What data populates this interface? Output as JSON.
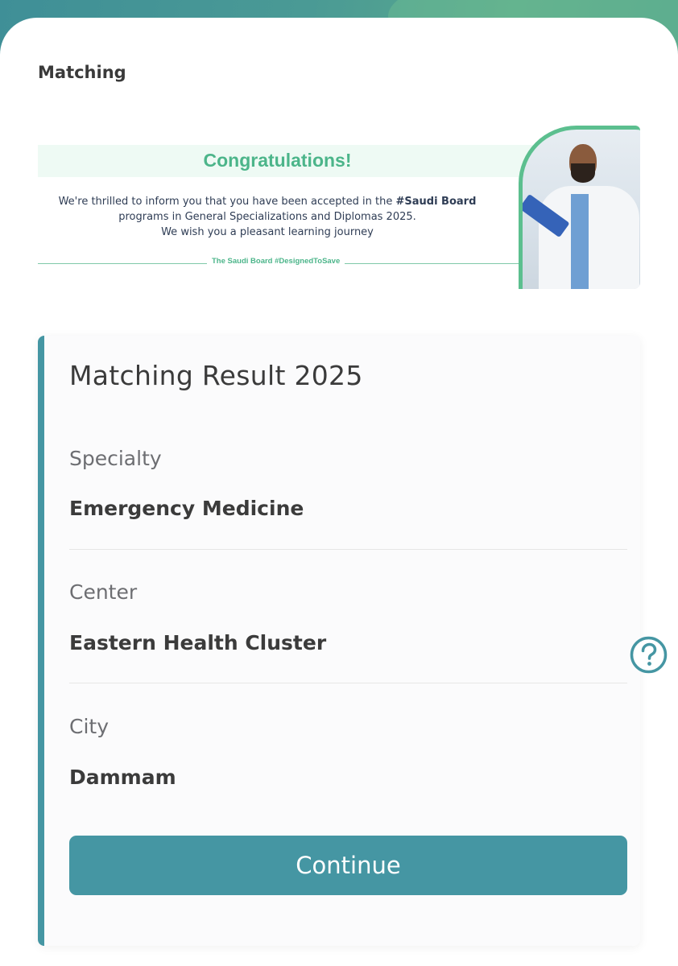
{
  "header": {
    "title": "Matching"
  },
  "banner": {
    "heading": "Congratulations!",
    "message_part1": "We're thrilled to inform you that you have been accepted in the ",
    "message_bold": "#Saudi Board",
    "message_part2": "programs in General Specializations and Diplomas 2025.",
    "message_part3": "We wish you a pleasant learning journey",
    "tagline": "The Saudi Board #DesignedToSave"
  },
  "result": {
    "title": "Matching Result 2025",
    "specialty_label": "Specialty",
    "specialty_value": "Emergency Medicine",
    "center_label": "Center",
    "center_value": "Eastern Health Cluster",
    "city_label": "City",
    "city_value": "Dammam",
    "continue_label": "Continue"
  },
  "colors": {
    "accent": "#4596a3",
    "banner_green": "#4cb58a",
    "text_dark": "#3b3b3b",
    "text_muted": "#6d6e72"
  },
  "icons": {
    "help": "help-circle-question-icon"
  }
}
